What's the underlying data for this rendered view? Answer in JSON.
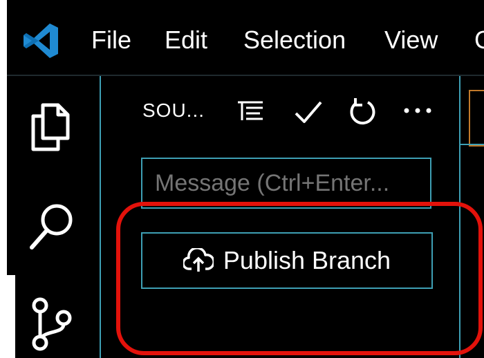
{
  "menubar": {
    "logo_icon": "vscode-logo-icon",
    "items": [
      {
        "label": "File"
      },
      {
        "label": "Edit"
      },
      {
        "label": "Selection"
      },
      {
        "label": "View"
      },
      {
        "label": "G"
      }
    ]
  },
  "activitybar": {
    "icons": [
      "explorer-files-icon",
      "search-icon",
      "source-control-icon"
    ]
  },
  "scm_panel": {
    "title": "SOU...",
    "toolbar_icons": [
      "view-as-tree-icon",
      "commit-check-icon",
      "refresh-icon",
      "more-actions-icon"
    ],
    "message_placeholder": "Message (Ctrl+Enter...",
    "publish_button_label": "Publish Branch",
    "publish_icon": "cloud-upload-icon"
  },
  "colors": {
    "background": "#000000",
    "border_accent": "#3ea0b5",
    "highlight": "#e3120b",
    "tab_border": "#c27a2a"
  }
}
